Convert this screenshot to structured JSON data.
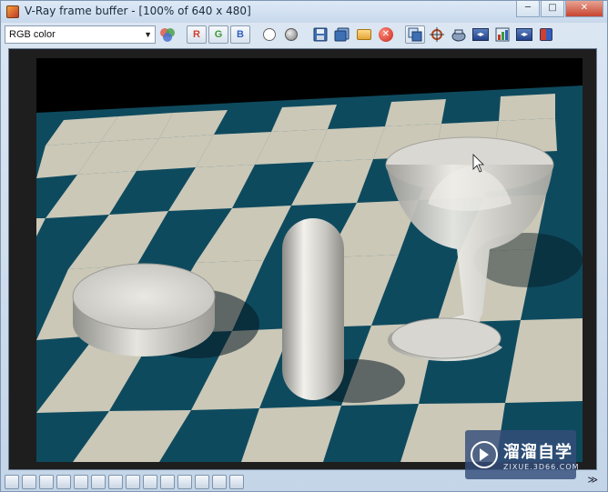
{
  "window": {
    "title": "V-Ray frame buffer - [100% of 640 x 480]",
    "minimize_glyph": "─",
    "maximize_glyph": "□",
    "close_glyph": "✕"
  },
  "toolbar": {
    "channel_select": {
      "value": "RGB color",
      "arrow": "▼"
    },
    "red_channel_label": "R",
    "green_channel_label": "G",
    "blue_channel_label": "B",
    "clear_glyph": "✕"
  },
  "statusbar": {
    "expand_glyph": "≫"
  },
  "watermark": {
    "title": "溜溜自学",
    "subtitle": "ZIXUE.3D66.COM"
  },
  "colors": {
    "checker_dark": "#0e4a5e",
    "checker_light": "#cbc8b8",
    "render_bg": "#000000"
  }
}
